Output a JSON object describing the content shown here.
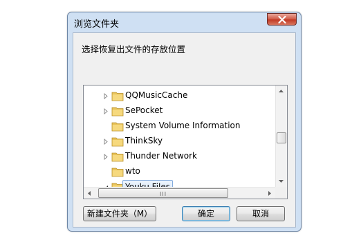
{
  "dialog": {
    "title": "浏览文件夹",
    "prompt": "选择恢复出文件的存放位置"
  },
  "tree": {
    "items": [
      {
        "label": "QQMusicCache",
        "expandable": true,
        "expanded": false,
        "selected": false
      },
      {
        "label": "SePocket",
        "expandable": true,
        "expanded": false,
        "selected": false
      },
      {
        "label": "System Volume Information",
        "expandable": false,
        "expanded": false,
        "selected": false
      },
      {
        "label": "ThinkSky",
        "expandable": true,
        "expanded": false,
        "selected": false
      },
      {
        "label": "Thunder Network",
        "expandable": true,
        "expanded": false,
        "selected": false
      },
      {
        "label": "wto",
        "expandable": false,
        "expanded": false,
        "selected": false
      },
      {
        "label": "Youku Files",
        "expandable": true,
        "expanded": true,
        "selected": true
      }
    ],
    "horizontal_grip": "III"
  },
  "buttons": {
    "new_folder": "新建文件夹（M）",
    "ok": "确定",
    "cancel": "取消"
  },
  "colors": {
    "title_bar": "#cfe0f3",
    "close_button": "#c23b26",
    "selection_border": "#84acdd",
    "folder": "#e8c35a"
  }
}
